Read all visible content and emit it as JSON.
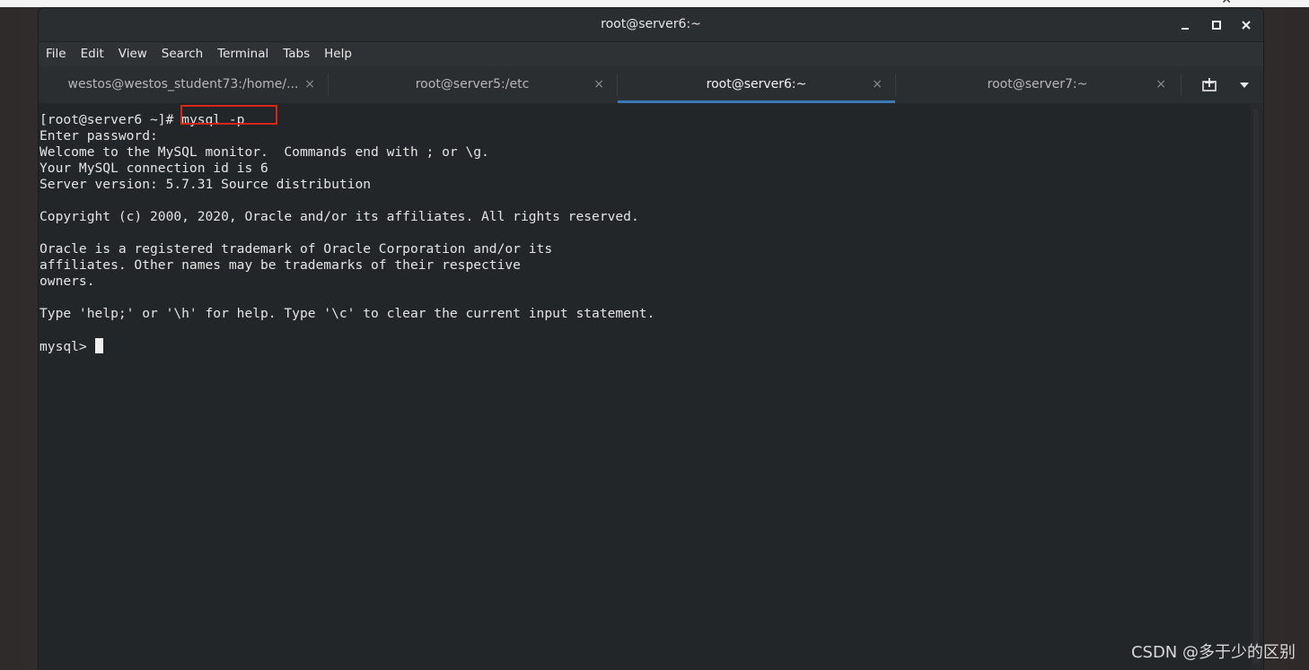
{
  "window": {
    "title": "root@server6:~"
  },
  "menu": [
    "File",
    "Edit",
    "View",
    "Search",
    "Terminal",
    "Tabs",
    "Help"
  ],
  "tabs": [
    {
      "label": "westos@westos_student73:/home/...",
      "active": false
    },
    {
      "label": "root@server5:/etc",
      "active": false
    },
    {
      "label": "root@server6:~",
      "active": true
    },
    {
      "label": "root@server7:~",
      "active": false
    }
  ],
  "tab_close_glyph": "×",
  "terminal": {
    "prompt": "[root@server6 ~]# ",
    "command": "mysql -p",
    "lines": [
      "Enter password:",
      "Welcome to the MySQL monitor.  Commands end with ; or \\g.",
      "Your MySQL connection id is 6",
      "Server version: 5.7.31 Source distribution",
      "",
      "Copyright (c) 2000, 2020, Oracle and/or its affiliates. All rights reserved.",
      "",
      "Oracle is a registered trademark of Oracle Corporation and/or its",
      "affiliates. Other names may be trademarks of their respective",
      "owners.",
      "",
      "Type 'help;' or '\\h' for help. Type '\\c' to clear the current input statement.",
      ""
    ],
    "mysql_prompt": "mysql> "
  },
  "colors": {
    "highlight_box": "#d9261c",
    "active_tab_underline": "#3b78b8",
    "terminal_bg": "#232628"
  },
  "icons": [
    "minimize-icon",
    "maximize-icon",
    "close-icon",
    "new-tab-icon",
    "tabs-menu-chevron-icon"
  ],
  "watermark": "CSDN @多于少的区别"
}
